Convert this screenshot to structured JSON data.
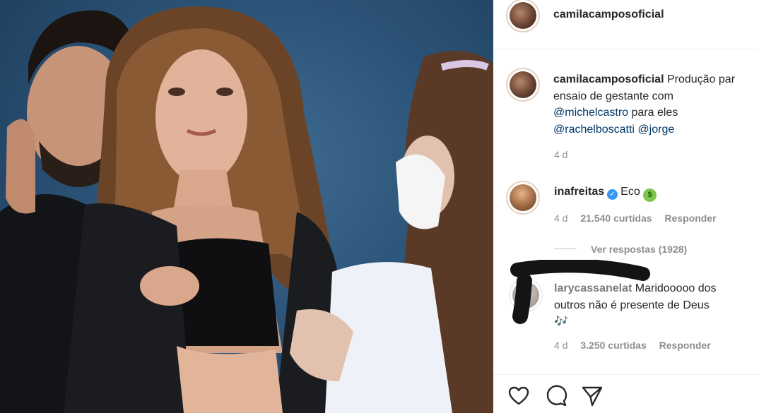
{
  "post": {
    "author": "camilacamposoficial",
    "caption": {
      "author": "camilacamposoficial",
      "line1_text": "Produção par",
      "line2_text": "ensaio de gestante com",
      "mention_michel": "@michelcastro",
      "line3_text": "para eles",
      "mention_rachel": "@rachelboscatti",
      "mention_jorge": "@jorge",
      "time": "4 d"
    }
  },
  "comments": [
    {
      "username": "inafreitas",
      "verified": true,
      "text": "Eco",
      "emoji": "money-face-emoji",
      "time": "4 d",
      "likes": "21.540 curtidas",
      "reply_label": "Responder",
      "view_replies": "Ver respostas (1928)"
    },
    {
      "username": "larycassanelat",
      "username_obscured": true,
      "text_line1": "Maridooooo dos",
      "text_line2": "outros não é presente de Deus",
      "emoji_text": "🎶",
      "time": "4 d",
      "likes": "3.250 curtidas",
      "reply_label": "Responder"
    }
  ],
  "actions": {
    "like_icon": "heart-icon",
    "comment_icon": "comment-bubble-icon",
    "share_icon": "paper-plane-icon"
  },
  "colors": {
    "mention": "#00376b",
    "meta": "#8e8e8e",
    "verified": "#3897f0",
    "photo_background": "#2c5478"
  }
}
